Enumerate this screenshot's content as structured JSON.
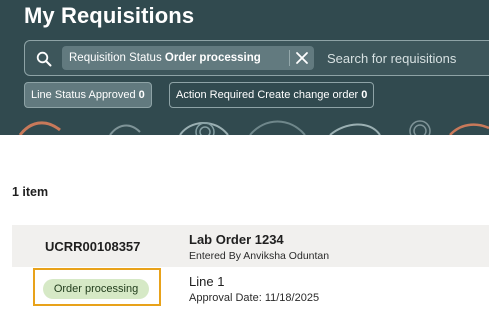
{
  "page": {
    "title": "My Requisitions"
  },
  "search": {
    "filter_chip": {
      "label": "Requisition Status",
      "value": "Order processing",
      "remove_icon": "close-icon"
    },
    "placeholder": "Search for requisitions",
    "search_icon": "search-icon"
  },
  "quick_filters": [
    {
      "label": "Line Status Approved",
      "count": "0",
      "active": true
    },
    {
      "label": "Action Required Create change order",
      "count": "0",
      "active": false
    }
  ],
  "results": {
    "count_label": "1 item",
    "items": [
      {
        "requisition_number": "UCRR00108357",
        "title": "Lab Order 1234",
        "entered_by": "Entered By Anviksha Oduntan",
        "status": "Order processing",
        "line": "Line 1",
        "approval_date": "Approval Date: 11/18/2025"
      }
    ]
  },
  "colors": {
    "header_bg": "#314a4f",
    "chip_bg": "#627a7f",
    "status_badge_bg": "#d6e9c6",
    "highlight_border": "#e8a21a",
    "row_bg": "#f1f0ee"
  }
}
